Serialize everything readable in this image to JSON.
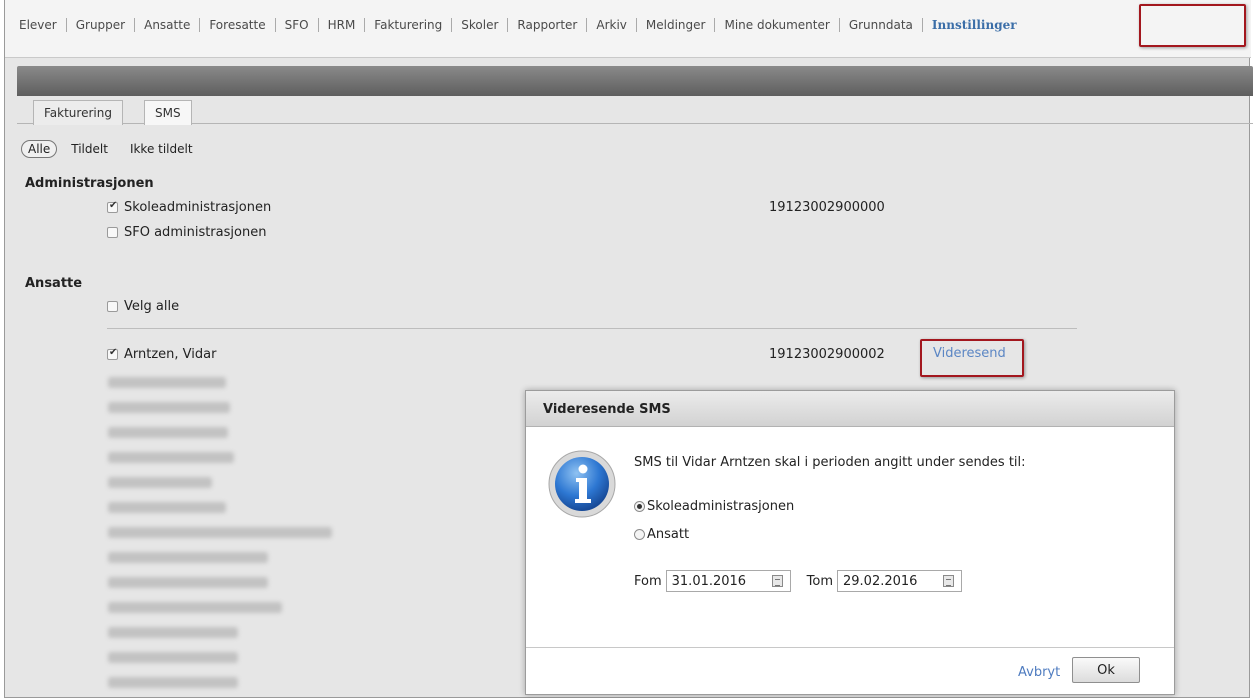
{
  "nav": {
    "items": [
      "Elever",
      "Grupper",
      "Ansatte",
      "Foresatte",
      "SFO",
      "HRM",
      "Fakturering",
      "Skoler",
      "Rapporter",
      "Arkiv",
      "Meldinger",
      "Mine dokumenter",
      "Grunndata",
      "Innstillinger"
    ],
    "active": "Innstillinger"
  },
  "tabs": [
    "Fakturering",
    "SMS"
  ],
  "filter": {
    "all": "Alle",
    "assigned": "Tildelt",
    "unassigned": "Ikke tildelt"
  },
  "admin": {
    "title": "Administrasjonen",
    "items": [
      {
        "label": "Skoleadministrasjonen",
        "checked": true,
        "number": "19123002900000"
      },
      {
        "label": "SFO administrasjonen",
        "checked": false,
        "number": ""
      }
    ]
  },
  "employees": {
    "title": "Ansatte",
    "select_all": "Velg alle",
    "first": {
      "label": "Arntzen, Vidar",
      "checked": true,
      "number": "19123002900002",
      "action": "Videresend"
    }
  },
  "dialog": {
    "title": "Videresende SMS",
    "message": "SMS til Vidar Arntzen skal i perioden angitt under sendes til:",
    "options": [
      "Skoleadministrasjonen",
      "Ansatt"
    ],
    "selected": "Skoleadministrasjonen",
    "from_label": "Fom",
    "from_value": "31.01.2016",
    "to_label": "Tom",
    "to_value": "29.02.2016",
    "cancel": "Avbryt",
    "ok": "Ok"
  },
  "colors": {
    "accent": "#3b6ea8",
    "highlight": "#a3171e",
    "link": "#5b86c4"
  }
}
